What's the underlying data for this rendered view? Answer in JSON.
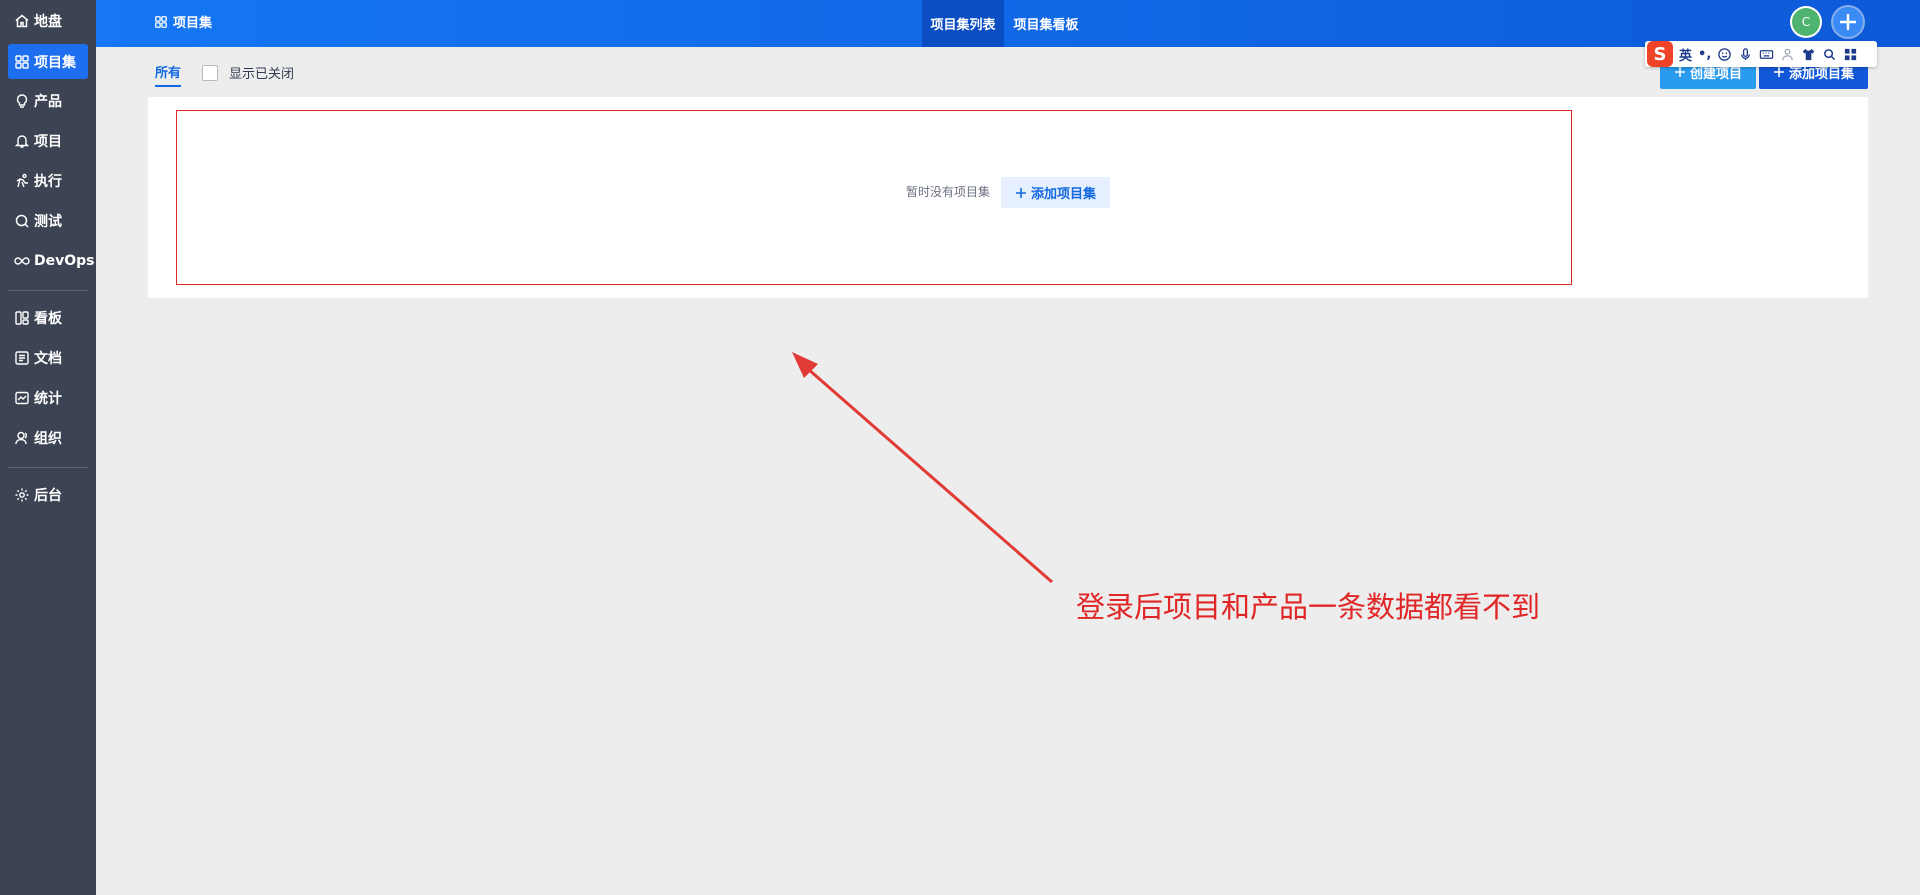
{
  "sidebar": {
    "items": [
      {
        "label": "地盘",
        "icon": "home-icon",
        "active": false
      },
      {
        "label": "项目集",
        "icon": "grid-icon",
        "active": true
      },
      {
        "label": "产品",
        "icon": "lightbulb-icon",
        "active": false
      },
      {
        "label": "项目",
        "icon": "bell-icon",
        "active": false
      },
      {
        "label": "执行",
        "icon": "runner-icon",
        "active": false
      },
      {
        "label": "测试",
        "icon": "magnify-icon",
        "active": false
      },
      {
        "label": "DevOps",
        "icon": "infinity-icon",
        "active": false
      },
      {
        "label": "看板",
        "icon": "kanban-icon",
        "active": false
      },
      {
        "label": "文档",
        "icon": "doc-icon",
        "active": false
      },
      {
        "label": "统计",
        "icon": "chart-icon",
        "active": false
      },
      {
        "label": "组织",
        "icon": "people-icon",
        "active": false
      },
      {
        "label": "后台",
        "icon": "gear-icon",
        "active": false
      }
    ]
  },
  "header": {
    "title": "项目集",
    "tabs": [
      {
        "label": "项目集列表",
        "active": true
      },
      {
        "label": "项目集看板",
        "active": false
      }
    ],
    "avatar_letter": "C"
  },
  "filters": {
    "all_label": "所有",
    "show_closed_label": "显示已关闭"
  },
  "actions": {
    "create_project": "创建项目",
    "add_program": "添加项目集"
  },
  "empty_state": {
    "message": "暂时没有项目集",
    "add_label": "添加项目集"
  },
  "ime": {
    "logo": "S",
    "lang": "英",
    "punct": "•,"
  },
  "annotation": {
    "text": "登录后项目和产品一条数据都看不到"
  },
  "colors": {
    "sidebar_bg": "#3c4353",
    "active": "#1d6ff0",
    "header_start": "#1577f3",
    "header_end": "#0d5ad8",
    "annotation": "#e02626"
  }
}
